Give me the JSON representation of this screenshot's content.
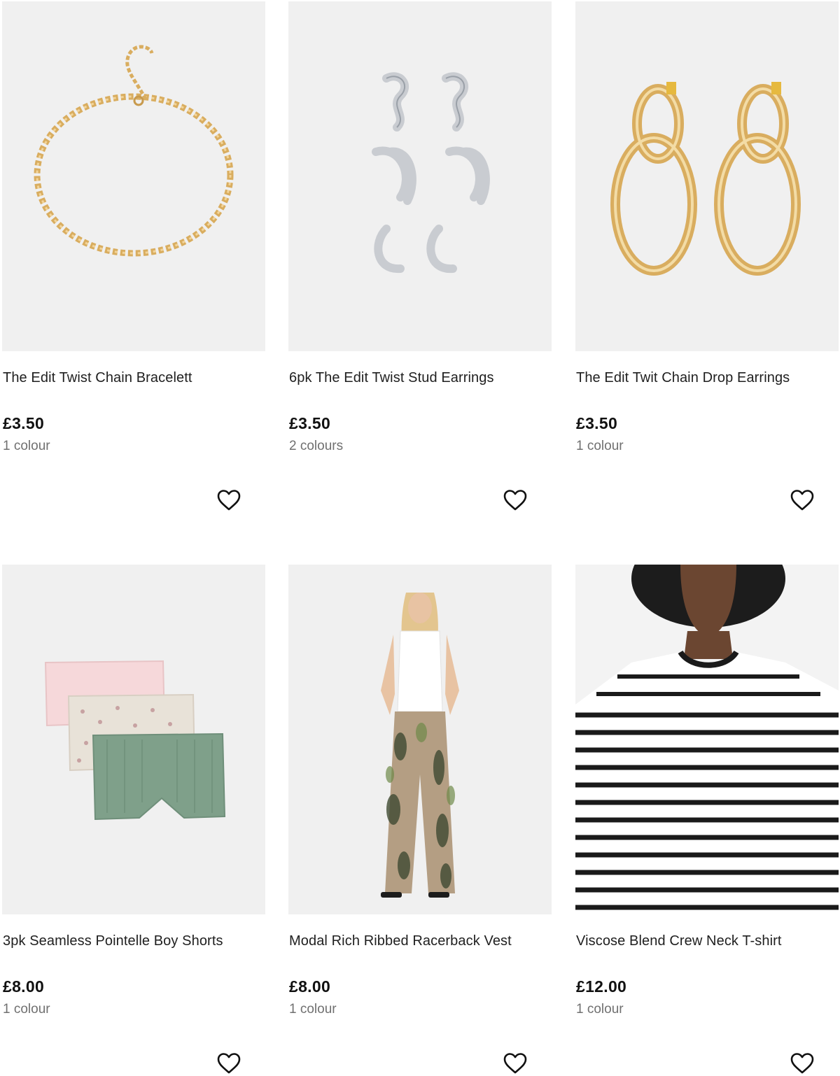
{
  "products": [
    {
      "title": "The Edit Twist Chain Bracelett",
      "price": "£3.50",
      "colours": "1 colour",
      "image_icon": "gold-chain-bracelet-image"
    },
    {
      "title": "6pk The Edit Twist Stud Earrings",
      "price": "£3.50",
      "colours": "2 colours",
      "image_icon": "silver-earrings-set-image"
    },
    {
      "title": "The Edit Twit Chain Drop Earrings",
      "price": "£3.50",
      "colours": "1 colour",
      "image_icon": "gold-drop-earrings-image"
    },
    {
      "title": "3pk Seamless Pointelle Boy Shorts",
      "price": "£8.00",
      "colours": "1 colour",
      "image_icon": "boy-shorts-image"
    },
    {
      "title": "Modal Rich Ribbed Racerback Vest",
      "price": "£8.00",
      "colours": "1 colour",
      "image_icon": "model-vest-trousers-image"
    },
    {
      "title": "Viscose Blend Crew Neck T-shirt",
      "price": "£12.00",
      "colours": "1 colour",
      "image_icon": "striped-tshirt-image"
    }
  ],
  "wishlist_icon": "heart-outline-icon",
  "colors": {
    "image_bg": "#f0f0f0",
    "price_text": "#111111",
    "secondary_text": "#707070",
    "gold": "#d9ad5f",
    "silver": "#c9ccd1"
  }
}
